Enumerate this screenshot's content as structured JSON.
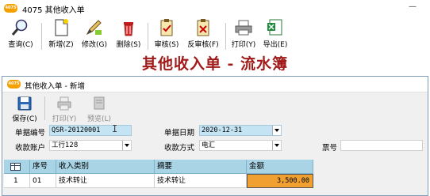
{
  "outer_window": {
    "title": "4075 其他收入单",
    "icon_label": "4075",
    "minimize_glyph": "—"
  },
  "toolbar": {
    "query": "查询(C)",
    "new": "新增(Z)",
    "edit": "修改(G)",
    "delete": "删除(S)",
    "audit": "审核(S)",
    "unaudit": "反审核(F)",
    "print": "打印(Y)",
    "export": "导出(E)"
  },
  "banner": {
    "title": "其他收入单 - 流水簿"
  },
  "inner_window": {
    "title": "其他收入单 - 新增",
    "icon_label": "4075",
    "toolbar": {
      "save": "保存(C)",
      "print": "打印(Y)",
      "preview": "预览(L)"
    },
    "form": {
      "doc_no_label": "单据编号",
      "doc_no_value": "QSR-20120001",
      "doc_date_label": "单据日期",
      "doc_date_value": "2020-12-31",
      "account_label": "收款账户",
      "account_value": "工行128",
      "method_label": "收款方式",
      "method_value": "电汇",
      "invoice_label": "票号",
      "invoice_value": ""
    },
    "grid": {
      "columns": [
        "序号",
        "收入类别",
        "摘要",
        "金额"
      ],
      "rows": [
        {
          "row_index": "1",
          "seq": "01",
          "category": "技术转让",
          "summary": "技术转让",
          "amount": "3,500.00"
        }
      ]
    }
  }
}
